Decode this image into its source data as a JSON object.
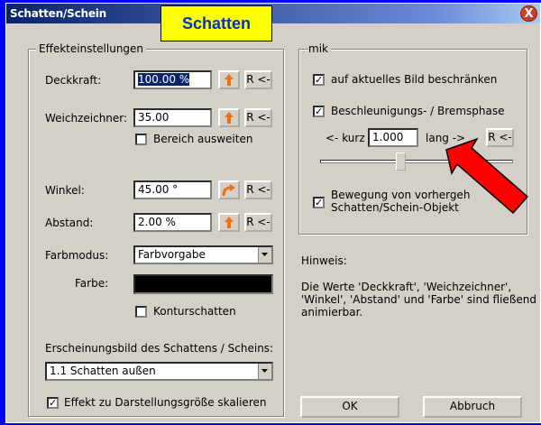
{
  "window": {
    "title": "Schatten/Schein",
    "close_label": "X"
  },
  "callout": {
    "text": "Schatten"
  },
  "effects": {
    "legend": "Effekteinstellungen",
    "opacity": {
      "label": "Deckkraft:",
      "value": "100.00 %",
      "reset": "R <-"
    },
    "blur": {
      "label": "Weichzeichner:",
      "value": "35.00",
      "reset": "R <-"
    },
    "expand_area": {
      "label": "Bereich ausweiten",
      "checked": false
    },
    "angle": {
      "label": "Winkel:",
      "value": "45.00 °",
      "reset": "R <-"
    },
    "distance": {
      "label": "Abstand:",
      "value": "2.00 %",
      "reset": "R <-"
    },
    "color_mode": {
      "label": "Farbmodus:",
      "value": "Farbvorgabe"
    },
    "color": {
      "label": "Farbe:",
      "swatch": "#000000"
    },
    "contour_shadow": {
      "label": "Konturschatten",
      "checked": false
    },
    "appearance": {
      "label": "Erscheinungsbild des Schattens / Scheins:",
      "value": "1.1 Schatten außen"
    },
    "scale_effect": {
      "label": "Effekt zu Darstellungsgröße skalieren",
      "checked": true
    }
  },
  "dynamics": {
    "legend": "mik",
    "limit_to_image": {
      "label": "auf aktuelles Bild beschränken",
      "checked": true
    },
    "accel_phase": {
      "label": "Beschleunigungs- / Bremsphase",
      "checked": true
    },
    "short_label": "<- kurz",
    "accel_value": "1.000",
    "long_label": "lang ->",
    "reset": "R <-",
    "slider_position": 0.46,
    "motion_object": {
      "label_line1": "Bewegung von vorhergeh",
      "label_line2": "Schatten/Schein-Objekt",
      "checked": true
    }
  },
  "hint": {
    "title": "Hinweis:",
    "text_line1": "Die Werte 'Deckkraft', 'Weichzeichner',",
    "text_line2": "'Winkel', 'Abstand' und 'Farbe' sind fließend",
    "text_line3": "animierbar."
  },
  "buttons": {
    "ok": "OK",
    "cancel": "Abbruch"
  },
  "colors": {
    "callout_bg": "#ffff00",
    "callout_text": "#0033cc",
    "arrow": "#ff0000",
    "frame": "#0000ff"
  }
}
